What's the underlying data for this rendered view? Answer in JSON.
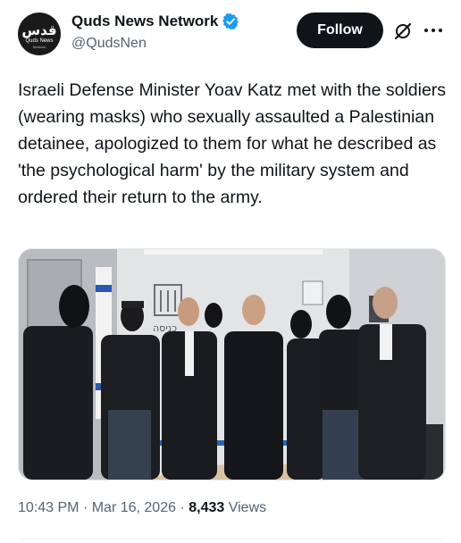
{
  "author": {
    "display_name": "Quds News Network",
    "handle": "@QudsNen",
    "avatar_text": "قدس",
    "avatar_subtext": "Quds News",
    "avatar_tagline": "Network",
    "verified": true
  },
  "actions": {
    "follow_label": "Follow",
    "grok_icon": "grok-icon",
    "more_icon": "more-options-icon"
  },
  "tweet": {
    "text": "Israeli Defense Minister Yoav Katz met with the soldiers (wearing masks) who sexually assaulted a Palestinian detainee, apologized to them for what he described as 'the psychological harm' by the military system and ordered their return to the army.",
    "media_sign_text": "כניסה"
  },
  "meta": {
    "time": "10:43 PM",
    "separator": "·",
    "date": "Mar 16, 2026",
    "views_count": "8,433",
    "views_label": "Views"
  },
  "colors": {
    "verified_blue": "#1d9bf0",
    "follow_bg": "#0f1419",
    "secondary_text": "#536471"
  }
}
